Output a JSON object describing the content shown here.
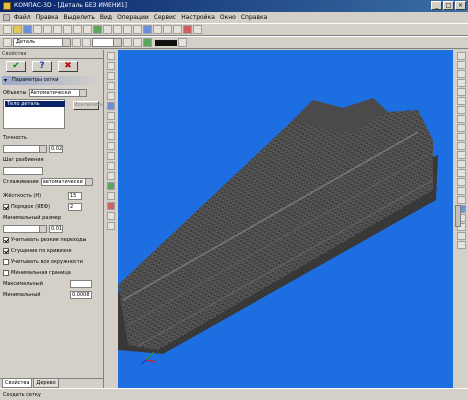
{
  "window": {
    "title": "КОМПАС-3D - [Деталь БЕЗ ИМЕНИ1]"
  },
  "menu": [
    "Файл",
    "Правка",
    "Выделить",
    "Вид",
    "Операции",
    "Сервис",
    "Настройка",
    "Окно",
    "Справка"
  ],
  "toolbar": {
    "combo_text": "Деталь"
  },
  "panel": {
    "header": "Свойства",
    "section_title": "Параметры сетки",
    "list_label": "Объекты",
    "list_mode": "Автоматически",
    "list_selected": "Тело деталь",
    "exclude_button": "Исключить",
    "rows": [
      {
        "label": "Точность",
        "value": "0.02"
      },
      {
        "label": "Шаг разбиения",
        "value": ""
      },
      {
        "label": "Сглаживание",
        "value": "автоматически"
      },
      {
        "label": "Жёсткость (Н)",
        "value": "15"
      },
      {
        "label": "Порядок (ЯЕФ)",
        "value": "2"
      },
      {
        "label": "Минимальный размер",
        "value": "0.01"
      }
    ],
    "checkboxes": [
      {
        "label": "Учитывать резкие переходы",
        "checked": true
      },
      {
        "label": "Сгущение по кривизне",
        "checked": true
      },
      {
        "label": "Учитывать все окружности",
        "checked": false
      },
      {
        "label": "Минимальная граница",
        "checked": false
      }
    ],
    "footer_rows": [
      {
        "label": "Максимальный",
        "value": ""
      },
      {
        "label": "Минимальный",
        "value": "0.0008"
      }
    ],
    "tabs": [
      "Свойства",
      "Дерево"
    ]
  },
  "status": {
    "text": "Создать сетку"
  },
  "colors": {
    "viewport_bg": "#1d6ee0",
    "title_bar": "#0a246a",
    "model": "#3a3a3a"
  }
}
